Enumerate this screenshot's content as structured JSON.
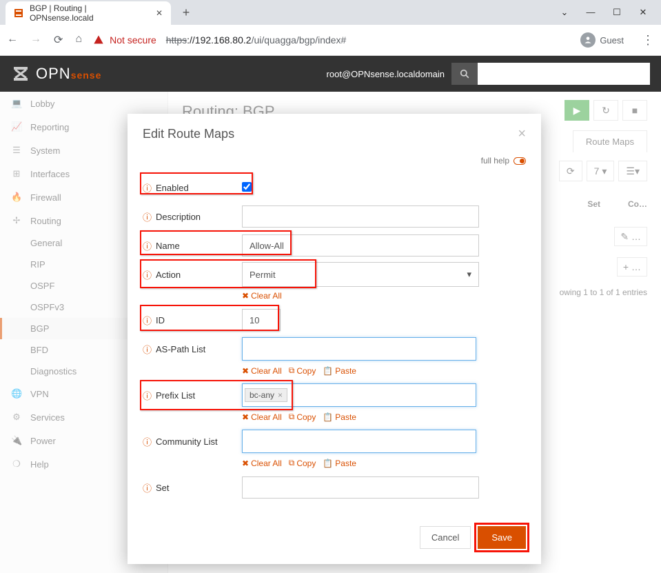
{
  "browser": {
    "tab_title": "BGP | Routing | OPNsense.locald",
    "url_insecure": "Not secure",
    "url_scheme": "https",
    "url_host": "://192.168.80.2",
    "url_path": "/ui/quagga/bgp/index#",
    "guest": "Guest"
  },
  "header": {
    "logo_main": "OPN",
    "logo_accent": "sense",
    "user": "root@OPNsense.localdomain"
  },
  "sidebar": {
    "lobby": "Lobby",
    "reporting": "Reporting",
    "system": "System",
    "interfaces": "Interfaces",
    "firewall": "Firewall",
    "routing": "Routing",
    "routing_children": {
      "general": "General",
      "rip": "RIP",
      "ospf": "OSPF",
      "ospfv3": "OSPFv3",
      "bgp": "BGP",
      "bfd": "BFD",
      "diagnostics": "Diagnostics"
    },
    "vpn": "VPN",
    "services": "Services",
    "power": "Power",
    "help": "Help"
  },
  "main": {
    "title": "Routing: BGP",
    "tab": "Route Maps",
    "page_size": "7",
    "col_set": "Set",
    "col_co": "Co…",
    "showing": "owing 1 to 1 of 1 entries"
  },
  "modal": {
    "title": "Edit Route Maps",
    "fullhelp": "full help",
    "labels": {
      "enabled": "Enabled",
      "description": "Description",
      "name": "Name",
      "action": "Action",
      "id": "ID",
      "aspath": "AS-Path List",
      "prefix": "Prefix List",
      "community": "Community List",
      "set": "Set"
    },
    "values": {
      "enabled": true,
      "description": "",
      "name": "Allow-All",
      "action": "Permit",
      "id": "10",
      "prefix_tag": "bc-any",
      "set": ""
    },
    "helpers": {
      "clearall": "Clear All",
      "copy": "Copy",
      "paste": "Paste"
    },
    "buttons": {
      "cancel": "Cancel",
      "save": "Save"
    }
  }
}
